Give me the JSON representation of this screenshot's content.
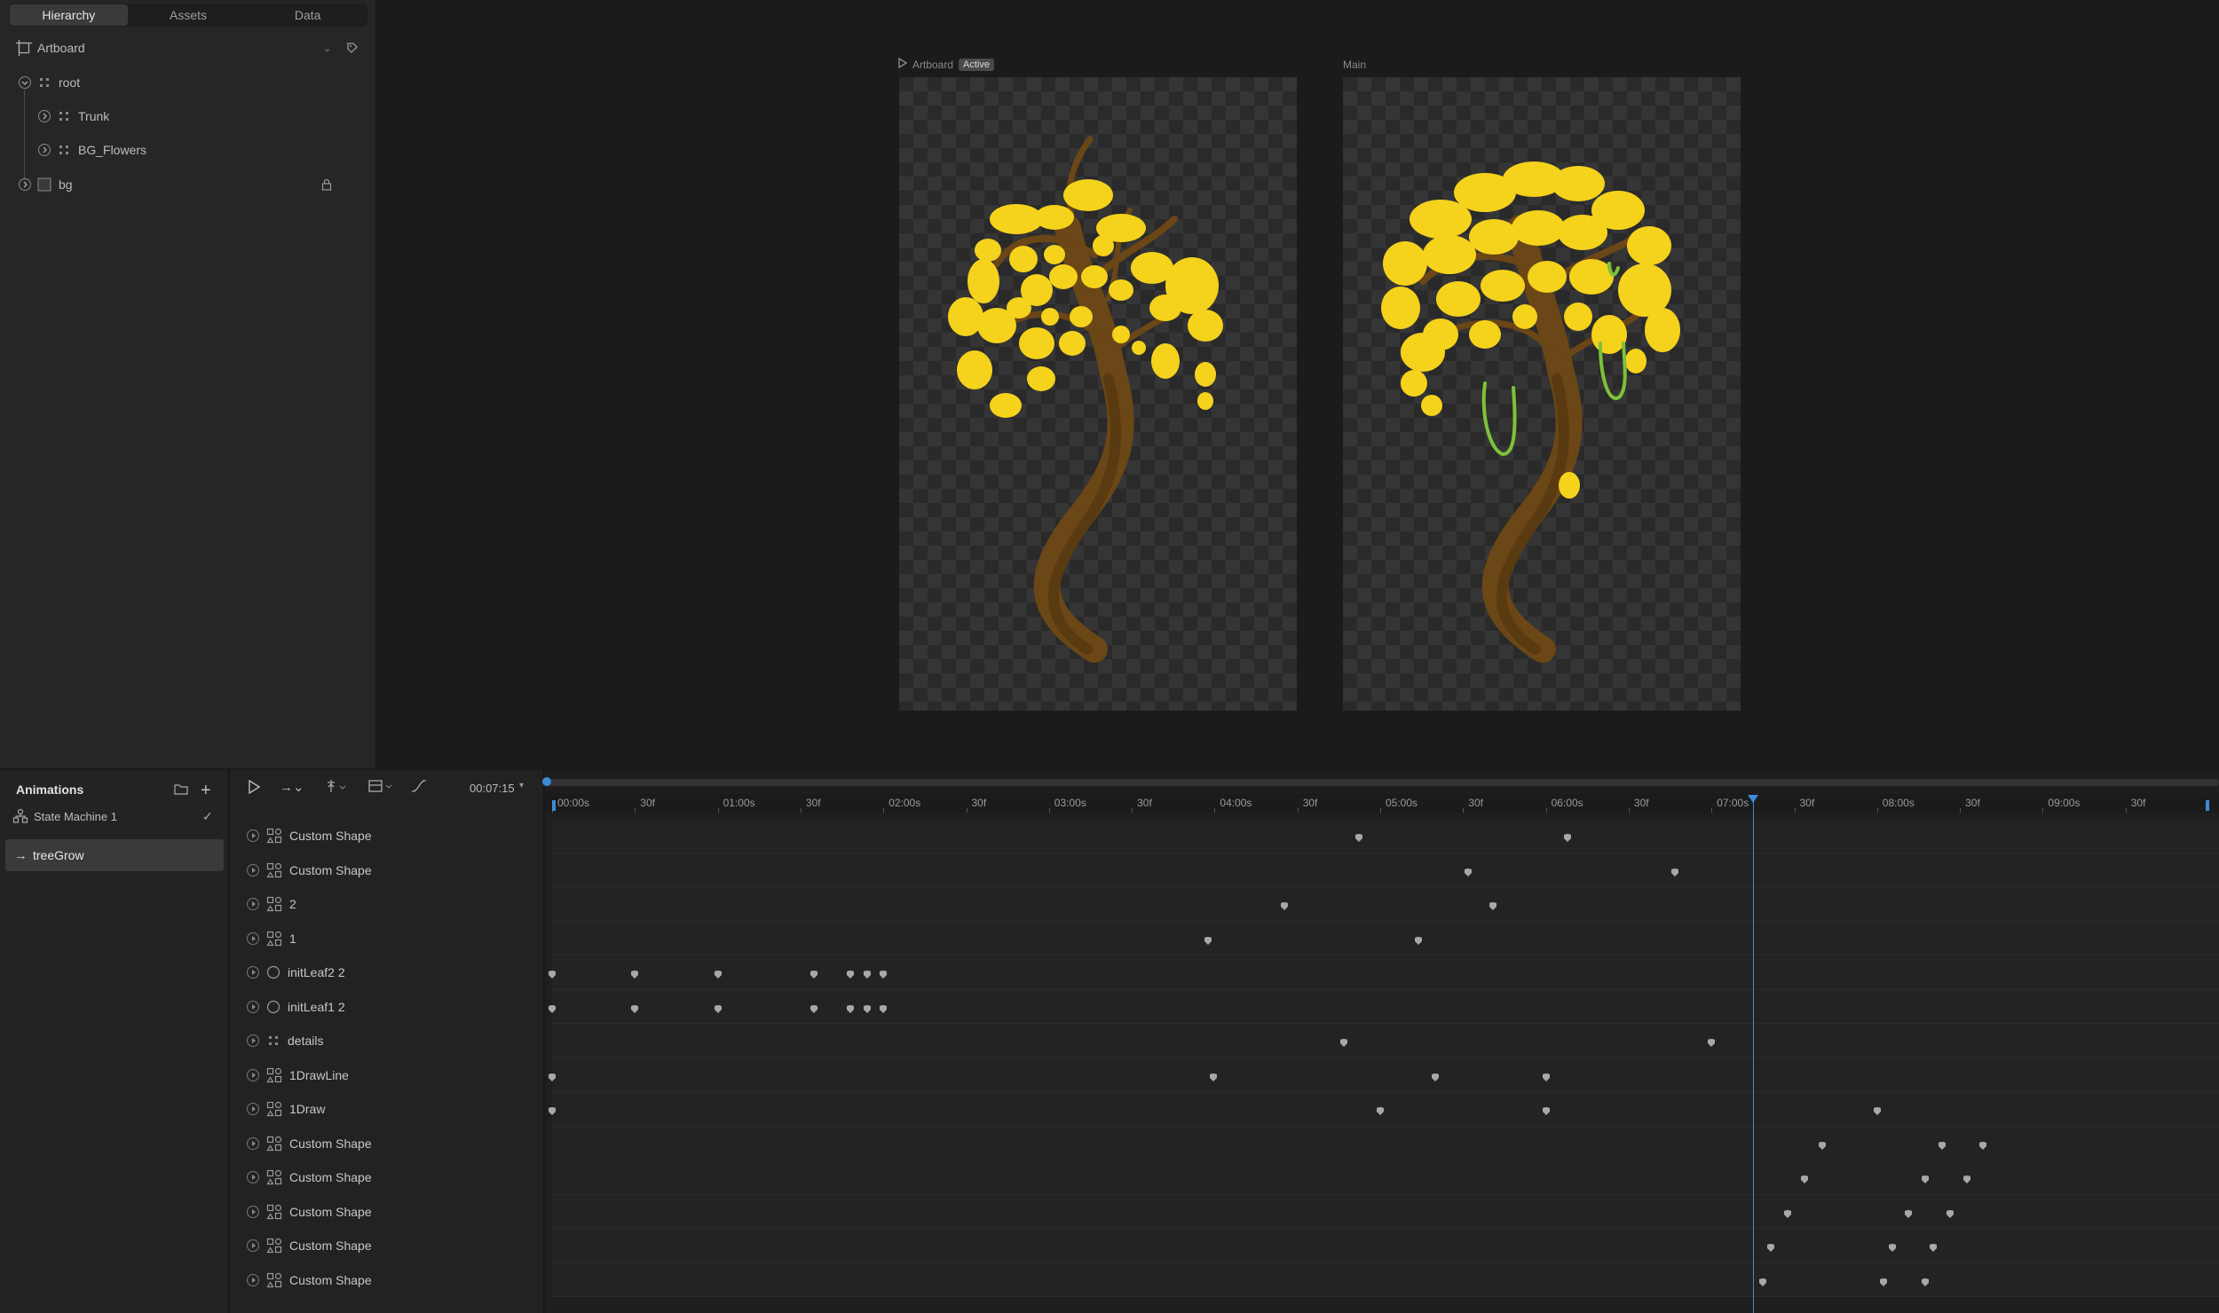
{
  "hierarchy_panel": {
    "tabs": [
      {
        "label": "Hierarchy",
        "active": true
      },
      {
        "label": "Assets",
        "active": false
      },
      {
        "label": "Data",
        "active": false
      }
    ],
    "artboard_label": "Artboard",
    "nodes": [
      {
        "label": "root",
        "depth": 0,
        "icon": "group-icon"
      },
      {
        "label": "Trunk",
        "depth": 1,
        "icon": "group-icon"
      },
      {
        "label": "BG_Flowers",
        "depth": 1,
        "icon": "group-icon"
      },
      {
        "label": "bg",
        "depth": 0,
        "icon": "shape-icon",
        "locked": true
      }
    ]
  },
  "stage": {
    "artboards": [
      {
        "label": "Artboard",
        "badge": "Active"
      },
      {
        "label": "Main",
        "badge": ""
      }
    ]
  },
  "animations_panel": {
    "title": "Animations",
    "state_machine": "State Machine 1",
    "selected_animation": "treeGrow"
  },
  "timeline": {
    "time_display": "00:07:15",
    "ruler_labels": [
      "00:00s",
      "30f",
      "01:00s",
      "30f",
      "02:00s",
      "30f",
      "03:00s",
      "30f",
      "04:00s",
      "30f",
      "05:00s",
      "30f",
      "06:00s",
      "30f",
      "07:00s",
      "30f",
      "08:00s",
      "30f",
      "09:00s",
      "30f"
    ],
    "playhead_seconds": 7.25,
    "layers": [
      {
        "name": "Custom Shape",
        "icon": "shapes-icon",
        "keys": [
          4.87,
          6.13
        ]
      },
      {
        "name": "Custom Shape",
        "icon": "shapes-icon",
        "keys": [
          5.53,
          6.78
        ]
      },
      {
        "name": "2",
        "icon": "shapes-icon",
        "keys": [
          4.42,
          5.68
        ]
      },
      {
        "name": "1",
        "icon": "shapes-icon",
        "keys": [
          3.96,
          5.23
        ]
      },
      {
        "name": "initLeaf2 2",
        "icon": "ellipse-icon",
        "keys": [
          0.0,
          0.5,
          1.0,
          1.58,
          1.8,
          1.9,
          2.0
        ]
      },
      {
        "name": "initLeaf1 2",
        "icon": "ellipse-icon",
        "keys": [
          0.0,
          0.5,
          1.0,
          1.58,
          1.8,
          1.9,
          2.0
        ]
      },
      {
        "name": "details",
        "icon": "group-icon",
        "keys": [
          4.78,
          7.0
        ]
      },
      {
        "name": "1DrawLine",
        "icon": "shapes-icon",
        "keys": [
          0.0,
          3.99,
          5.33,
          6.0
        ]
      },
      {
        "name": "1Draw",
        "icon": "shapes-icon",
        "keys": [
          0.0,
          5.0,
          6.0,
          8.0
        ]
      },
      {
        "name": "Custom Shape",
        "icon": "shapes-icon",
        "keys": [
          7.67,
          8.39,
          8.64
        ]
      },
      {
        "name": "Custom Shape",
        "icon": "shapes-icon",
        "keys": [
          7.56,
          8.29,
          8.54
        ]
      },
      {
        "name": "Custom Shape",
        "icon": "shapes-icon",
        "keys": [
          7.46,
          8.19,
          8.44
        ]
      },
      {
        "name": "Custom Shape",
        "icon": "shapes-icon",
        "keys": [
          7.36,
          8.09,
          8.34
        ]
      },
      {
        "name": "Custom Shape",
        "icon": "shapes-icon",
        "keys": [
          7.31,
          8.04,
          8.29
        ]
      }
    ]
  },
  "colors": {
    "accent": "#3d8bd6",
    "flower_yellow": "#f5d21c",
    "trunk_brown": "#6b4616",
    "vine_green": "#7cc23a"
  }
}
